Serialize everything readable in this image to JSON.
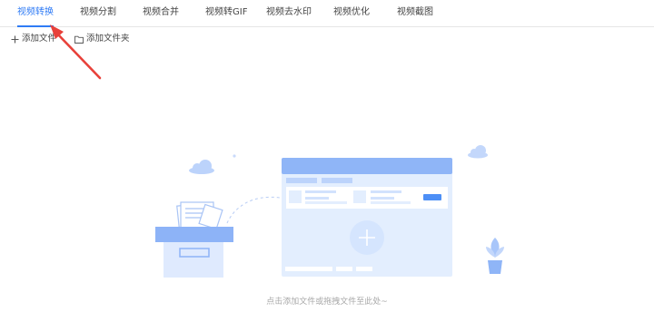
{
  "tabs": [
    {
      "label": "视频转换",
      "active": true
    },
    {
      "label": "视频分割",
      "active": false
    },
    {
      "label": "视频合并",
      "active": false
    },
    {
      "label": "视频转GIF",
      "active": false
    },
    {
      "label": "视频去水印",
      "active": false
    },
    {
      "label": "视频优化",
      "active": false
    },
    {
      "label": "视频截图",
      "active": false
    }
  ],
  "toolbar": {
    "add_file_label": "添加文件",
    "add_folder_label": "添加文件夹"
  },
  "dropzone": {
    "hint": "点击添加文件或拖拽文件至此处~"
  },
  "colors": {
    "accent": "#2f7bf5",
    "illustration_blue": "#8fb5f7",
    "illustration_light": "#e5efff",
    "annotation_arrow": "#e8413a"
  }
}
